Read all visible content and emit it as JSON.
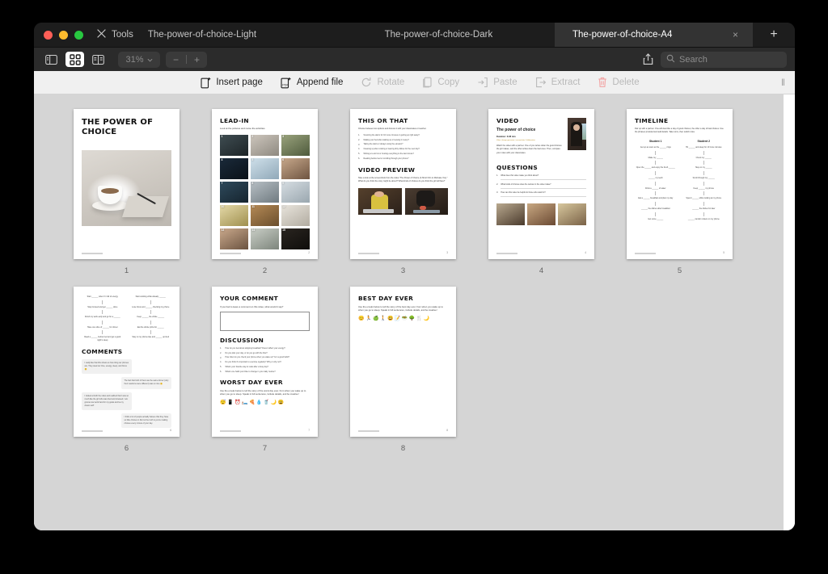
{
  "window": {
    "traffic_lights": [
      "close",
      "minimize",
      "zoom"
    ],
    "tools_label": "Tools",
    "tabs": [
      {
        "label": "The-power-of-choice-Light",
        "active": false
      },
      {
        "label": "The-power-of-choice-Dark",
        "active": false
      },
      {
        "label": "The-power-of-choice-A4",
        "active": true
      }
    ],
    "new_tab_label": "+",
    "close_tab_label": "×"
  },
  "view_toolbar": {
    "buttons": [
      {
        "name": "sidebar-view",
        "active": false
      },
      {
        "name": "grid-view",
        "active": true
      },
      {
        "name": "split-view",
        "active": false
      }
    ],
    "zoom_value": "31%",
    "zoom_out": "−",
    "zoom_in": "+",
    "share_icon": "share-icon",
    "search_placeholder": "Search"
  },
  "action_toolbar": {
    "actions": [
      {
        "label": "Insert page",
        "icon": "insert-page-icon",
        "enabled": true
      },
      {
        "label": "Append file",
        "icon": "append-file-icon",
        "enabled": true
      },
      {
        "label": "Rotate",
        "icon": "rotate-icon",
        "enabled": false
      },
      {
        "label": "Copy",
        "icon": "copy-icon",
        "enabled": false
      },
      {
        "label": "Paste",
        "icon": "paste-icon",
        "enabled": false
      },
      {
        "label": "Extract",
        "icon": "extract-icon",
        "enabled": false
      },
      {
        "label": "Delete",
        "icon": "trash-icon",
        "enabled": false
      }
    ],
    "grip": "‖"
  },
  "colors": {
    "window_chrome": "#2b2b2b",
    "tab_active": "#333333",
    "canvas_bg": "#d5d5d5",
    "accent_delete": "#f0a0a0",
    "light_toolbar": "#f0f0f0"
  },
  "pages": [
    {
      "number": "1",
      "title": "THE POWER OF CHOICE",
      "kind": "cover",
      "footer_right": ""
    },
    {
      "number": "2",
      "title": "LEAD-IN",
      "subtitle": "Look at the pictures and name the activities",
      "kind": "photo-grid",
      "photo_numbers": [
        "1",
        "2",
        "3",
        "4",
        "5",
        "6",
        "7",
        "8",
        "9",
        "10",
        "11",
        "12",
        "13",
        "14",
        "15"
      ],
      "footer_right": "2"
    },
    {
      "number": "3",
      "title": "THIS OR THAT",
      "subtitle": "Choose between two options and discuss it with your classmates or teacher.",
      "items": [
        "Snoozing the alarm for 10 more minutes or getting up right away?",
        "Making your bed after waking up or leaving it messy?",
        "Taking the stairs or always using the elevator?",
        "Cleaning up after cooking or leaving dirty dishes for the next day?",
        "Writing a to-do list or trusting everything to the last minute?",
        "Reading before bed or scrolling through your phone?"
      ],
      "section2_title": "VIDEO PREVIEW",
      "section2_text": "Take a look at the screenshots from the video \"The Power of Choice (A Short Film to Motivate You).\" What do you think the story might be about? What kinds of choices do you think the girl will face?",
      "kind": "this-or-that",
      "footer_right": "3"
    },
    {
      "number": "4",
      "title": "VIDEO",
      "subtitle": "The power of choice",
      "duration_label": "Duration: 3:28 min",
      "link_label": "Video | Image generator | screenshots Collaboration",
      "body": "Watch the video with a partner. One of you writes down the good choices the girl makes, and the other writes down the bad ones. Then, compare your notes with your classmates.",
      "section2_title": "QUESTIONS",
      "questions": [
        "What does this video make you think about?",
        "What kinds of choices does the woman in the video make?",
        "How can this video be helpful to those who watch it?"
      ],
      "kind": "video",
      "footer_right": "4"
    },
    {
      "number": "5",
      "title": "TIMELINE",
      "subtitle": "Pair up with a partner. One will describe a day of good choices, the other a day of bad choices. Use the phrases provided and add details. Take turns, then switch roles.",
      "kind": "timeline",
      "columns": [
        {
          "head": "Student 1",
          "nodes": [
            "Get up as soon as the ______ rings",
            "Make my ______",
            "Open the ______ and enjoy the fresh ______",
            "______ my teeth",
            "Drink a ______ of water",
            "Eat a ______ breakfast and plan my day",
            "______ the dishes after breakfast",
            "Get some ______"
          ]
        },
        {
          "head": "Student 2",
          "nodes": [
            "Hit ______ and sleep for 10 more minutes",
            "Check my ______",
            "Stay on my ______",
            "Scroll through my ______",
            "Keep ______ my phone",
            "Spend ______ while looking at my phone",
            "______ the dishes for later",
            "______ random videos on my phone"
          ]
        }
      ],
      "footer_right": "5"
    },
    {
      "number": "6",
      "title": "COMMENTS",
      "kind": "comments",
      "timeline_tail": [
        [
          "Start ______ when I'm full of energy",
          "Stay focused and get ______ done",
          "Finish my work early and go for a ______",
          "Have one slice of ______ for dinner",
          "Read a ______ before bed and get a good night's sleep"
        ],
        [
          "Start working while already ______",
          "Lose focus and ______ checking my phone",
          "Keep ______ the whole ______",
          "Eat the whole pizza for ______",
          "Stay on my phone late and ______ up tired"
        ]
      ],
      "bubbles": [
        "I really like that this shows us how tiring our phones are. They steal our time, energy, sleep, and focus 😊",
        "The fact that both of them ate the same dinner (only their reactions were different) was so nice 😊",
        "I looked at both the video and realized that I was so much like the girl who was tired and stressed. I am gonna now work hard for my goals and be my dream self!",
        "I think a lot of people actually believe that they have so little choices in life but the truth is you're making choices every minute of your day."
      ],
      "footer_right": "6"
    },
    {
      "number": "7",
      "title": "YOUR COMMENT",
      "subtitle": "If you had to leave a comment on this video, what would it say?",
      "kind": "your-comment",
      "section2_title": "DISCUSSION",
      "questions": [
        "How do you feel about skipping breakfast? Does it affect your energy?",
        "Do you plan your day, or do you go with the flow?",
        "How often do you check your phone when you wake up? Is it a good habit?",
        "Do you think it's important to exercise regularly? Why or why not?",
        "What's your favorite way to relax after a busy day?",
        "What's one habit you'd like to change in your daily routine?"
      ],
      "section3_title": "WORST DAY EVER",
      "section3_text": "Use the emojis below to tell the story of the worst day ever, from when you wake up to when you go to sleep. Speak in full sentences, include details, and be creative!",
      "emojis": [
        "😴",
        "📱",
        "⏰",
        "🛏️",
        "🍕",
        "💧",
        "🥤",
        "🌙",
        "😩"
      ],
      "footer_right": "7"
    },
    {
      "number": "8",
      "title": "BEST DAY EVER",
      "subtitle": "Use the emojis below to tell the story of the best day ever, from when you wake up to when you go to sleep. Speak in full sentences, include details, and be creative!",
      "kind": "best-day",
      "emojis": [
        "😊",
        "🏃",
        "🍏",
        "🚶",
        "😃",
        "📝",
        "🥗",
        "🌳",
        "🍴",
        "🌙"
      ],
      "footer_right": "8"
    }
  ]
}
